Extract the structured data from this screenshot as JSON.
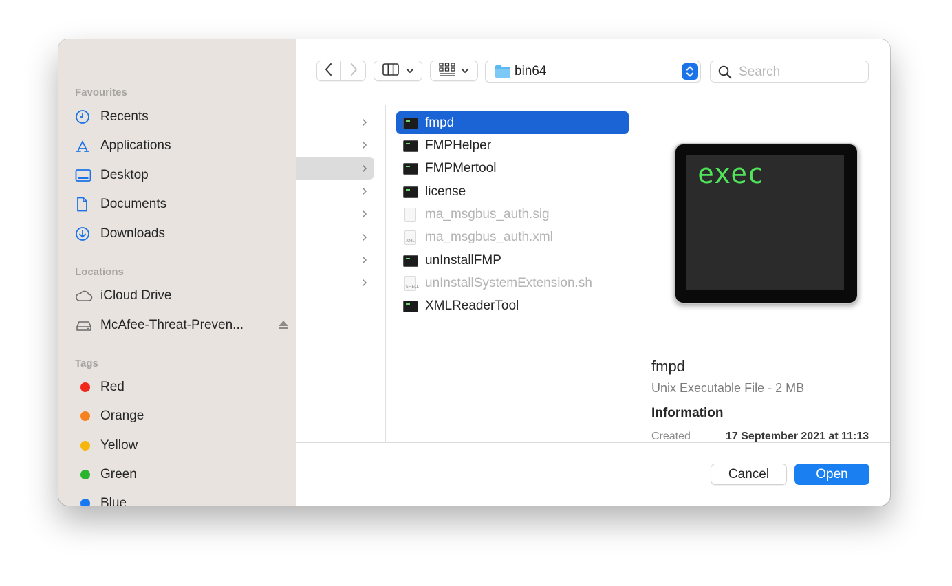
{
  "sidebar": {
    "favourites_heading": "Favourites",
    "favourites": [
      {
        "label": "Recents",
        "icon": "clock-icon"
      },
      {
        "label": "Applications",
        "icon": "applications-icon"
      },
      {
        "label": "Desktop",
        "icon": "desktop-icon"
      },
      {
        "label": "Documents",
        "icon": "document-icon"
      },
      {
        "label": "Downloads",
        "icon": "download-icon"
      }
    ],
    "locations_heading": "Locations",
    "locations": [
      {
        "label": "iCloud Drive",
        "icon": "cloud-icon"
      },
      {
        "label": "McAfee-Threat-Preven...",
        "icon": "drive-icon",
        "eject": "eject-icon"
      }
    ],
    "tags_heading": "Tags",
    "tags": [
      {
        "label": "Red",
        "color": "#f2271c"
      },
      {
        "label": "Orange",
        "color": "#f5821f"
      },
      {
        "label": "Yellow",
        "color": "#f6b70d"
      },
      {
        "label": "Green",
        "color": "#2bb430"
      },
      {
        "label": "Blue",
        "color": "#1877f2"
      }
    ]
  },
  "toolbar": {
    "back_icon": "chevron-left-icon",
    "forward_icon": "chevron-right-icon",
    "column_view_icon": "column-view-icon",
    "group_icon": "icon-grid-icon",
    "current_folder": "bin64",
    "search_placeholder": "Search"
  },
  "files": [
    {
      "name": "fmpd",
      "type": "exec",
      "selected": true
    },
    {
      "name": "FMPHelper",
      "type": "exec"
    },
    {
      "name": "FMPMertool",
      "type": "exec"
    },
    {
      "name": "license",
      "type": "exec"
    },
    {
      "name": "ma_msgbus_auth.sig",
      "type": "doc",
      "dimmed": true
    },
    {
      "name": "ma_msgbus_auth.xml",
      "type": "xml",
      "dimmed": true
    },
    {
      "name": "unInstallFMP",
      "type": "exec"
    },
    {
      "name": "unInstallSystemExtension.sh",
      "type": "sh",
      "dimmed": true
    },
    {
      "name": "XMLReaderTool",
      "type": "exec"
    }
  ],
  "preview": {
    "icon_text": "exec",
    "name": "fmpd",
    "kind": "Unix Executable File - 2 MB",
    "info_heading": "Information",
    "created_label": "Created",
    "created_value": "17 September 2021 at 11:13"
  },
  "footer": {
    "cancel_label": "Cancel",
    "open_label": "Open"
  },
  "colors": {
    "accent": "#1a80f2",
    "selection": "#1a64d6",
    "sidebar_bg": "#e8e3df"
  }
}
